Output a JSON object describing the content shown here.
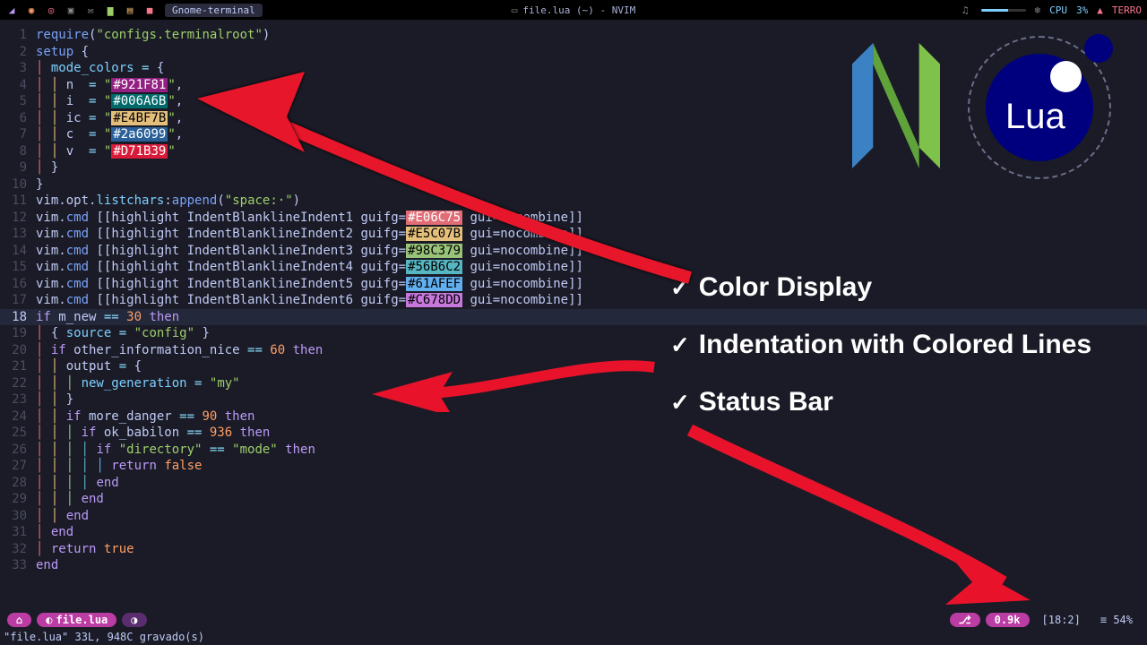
{
  "topbar": {
    "term_label": "Gnome-terminal",
    "file_label": "file.lua (~) - NVIM",
    "cpu_label": "CPU",
    "cpu_pct": "3%",
    "user": "TERRO"
  },
  "annotations": {
    "a1": "Color Display",
    "a2": "Indentation with Colored Lines",
    "a3": "Status Bar"
  },
  "code_lines": [
    {
      "n": "1",
      "tokens": [
        [
          "fn",
          "require"
        ],
        [
          "punct",
          "("
        ],
        [
          "str",
          "\"configs.terminalroot\""
        ],
        [
          "punct",
          ")"
        ]
      ]
    },
    {
      "n": "2",
      "tokens": [
        [
          "fn",
          "setup"
        ],
        [
          "punct",
          " {"
        ]
      ]
    },
    {
      "n": "3",
      "tokens": [
        [
          "indent1",
          "│ "
        ],
        [
          "prop",
          "mode_colors"
        ],
        [
          "op",
          " = "
        ],
        [
          "punct",
          "{"
        ]
      ]
    },
    {
      "n": "4",
      "tokens": [
        [
          "indent1",
          "│ "
        ],
        [
          "indent2",
          "│ "
        ],
        [
          "var",
          "n "
        ],
        [
          "op",
          " = "
        ],
        [
          "str",
          "\""
        ],
        [
          "swc",
          "#921F81",
          "#921F81"
        ],
        [
          "str",
          "\""
        ],
        [
          "punct",
          ","
        ]
      ]
    },
    {
      "n": "5",
      "tokens": [
        [
          "indent1",
          "│ "
        ],
        [
          "indent2",
          "│ "
        ],
        [
          "var",
          "i "
        ],
        [
          "op",
          " = "
        ],
        [
          "str",
          "\""
        ],
        [
          "swc",
          "#006A6B",
          "#006A6B"
        ],
        [
          "str",
          "\""
        ],
        [
          "punct",
          ","
        ]
      ]
    },
    {
      "n": "6",
      "tokens": [
        [
          "indent1",
          "│ "
        ],
        [
          "indent2",
          "│ "
        ],
        [
          "var",
          "ic"
        ],
        [
          "op",
          " = "
        ],
        [
          "str",
          "\""
        ],
        [
          "swc",
          "#E4BF7B",
          "#E4BF7B"
        ],
        [
          "str",
          "\""
        ],
        [
          "punct",
          ","
        ]
      ]
    },
    {
      "n": "7",
      "tokens": [
        [
          "indent1",
          "│ "
        ],
        [
          "indent2",
          "│ "
        ],
        [
          "var",
          "c "
        ],
        [
          "op",
          " = "
        ],
        [
          "str",
          "\""
        ],
        [
          "swc",
          "#2a6099",
          "#2a6099"
        ],
        [
          "str",
          "\""
        ],
        [
          "punct",
          ","
        ]
      ]
    },
    {
      "n": "8",
      "tokens": [
        [
          "indent1",
          "│ "
        ],
        [
          "indent2",
          "│ "
        ],
        [
          "var",
          "v "
        ],
        [
          "op",
          " = "
        ],
        [
          "str",
          "\""
        ],
        [
          "swc",
          "#D71B39",
          "#D71B39"
        ],
        [
          "str",
          "\""
        ]
      ]
    },
    {
      "n": "9",
      "tokens": [
        [
          "indent1",
          "│ "
        ],
        [
          "punct",
          "}"
        ]
      ]
    },
    {
      "n": "10",
      "tokens": [
        [
          "punct",
          "}"
        ]
      ]
    },
    {
      "n": "11",
      "tokens": [
        [
          "var",
          "vim"
        ],
        [
          "punct",
          "."
        ],
        [
          "var",
          "opt"
        ],
        [
          "punct",
          "."
        ],
        [
          "prop",
          "listchars"
        ],
        [
          "punct",
          ":"
        ],
        [
          "fn",
          "append"
        ],
        [
          "punct",
          "("
        ],
        [
          "str",
          "\"space:·\""
        ],
        [
          "punct",
          ")"
        ]
      ]
    },
    {
      "n": "12",
      "tokens": [
        [
          "var",
          "vim"
        ],
        [
          "punct",
          "."
        ],
        [
          "fn",
          "cmd"
        ],
        [
          "punct",
          " [["
        ],
        [
          "var",
          "highlight IndentBlanklineIndent1 guifg="
        ],
        [
          "swc",
          "#E06C75",
          "#E06C75"
        ],
        [
          "var",
          " gui=nocombine"
        ],
        [
          "punct",
          "]]"
        ]
      ]
    },
    {
      "n": "13",
      "tokens": [
        [
          "var",
          "vim"
        ],
        [
          "punct",
          "."
        ],
        [
          "fn",
          "cmd"
        ],
        [
          "punct",
          " [["
        ],
        [
          "var",
          "highlight IndentBlanklineIndent2 guifg="
        ],
        [
          "swc",
          "#E5C07B",
          "#E5C07B"
        ],
        [
          "var",
          " gui=nocombine"
        ],
        [
          "punct",
          "]]"
        ]
      ]
    },
    {
      "n": "14",
      "tokens": [
        [
          "var",
          "vim"
        ],
        [
          "punct",
          "."
        ],
        [
          "fn",
          "cmd"
        ],
        [
          "punct",
          " [["
        ],
        [
          "var",
          "highlight IndentBlanklineIndent3 guifg="
        ],
        [
          "swc",
          "#98C379",
          "#98C379"
        ],
        [
          "var",
          " gui=nocombine"
        ],
        [
          "punct",
          "]]"
        ]
      ]
    },
    {
      "n": "15",
      "tokens": [
        [
          "var",
          "vim"
        ],
        [
          "punct",
          "."
        ],
        [
          "fn",
          "cmd"
        ],
        [
          "punct",
          " [["
        ],
        [
          "var",
          "highlight IndentBlanklineIndent4 guifg="
        ],
        [
          "swc",
          "#56B6C2",
          "#56B6C2"
        ],
        [
          "var",
          " gui=nocombine"
        ],
        [
          "punct",
          "]]"
        ]
      ]
    },
    {
      "n": "16",
      "tokens": [
        [
          "var",
          "vim"
        ],
        [
          "punct",
          "."
        ],
        [
          "fn",
          "cmd"
        ],
        [
          "punct",
          " [["
        ],
        [
          "var",
          "highlight IndentBlanklineIndent5 guifg="
        ],
        [
          "swc",
          "#61AFEF",
          "#61AFEF"
        ],
        [
          "var",
          " gui=nocombine"
        ],
        [
          "punct",
          "]]"
        ]
      ]
    },
    {
      "n": "17",
      "tokens": [
        [
          "var",
          "vim"
        ],
        [
          "punct",
          "."
        ],
        [
          "fn",
          "cmd"
        ],
        [
          "punct",
          " [["
        ],
        [
          "var",
          "highlight IndentBlanklineIndent6 guifg="
        ],
        [
          "swc",
          "#C678DD",
          "#C678DD"
        ],
        [
          "var",
          " gui=nocombine"
        ],
        [
          "punct",
          "]]"
        ]
      ]
    },
    {
      "n": "18",
      "current": true,
      "tokens": [
        [
          "kw",
          "if"
        ],
        [
          "var",
          " m_new "
        ],
        [
          "op",
          "=="
        ],
        [
          "num",
          " 30 "
        ],
        [
          "kw",
          "then"
        ]
      ]
    },
    {
      "n": "19",
      "tokens": [
        [
          "indent1",
          "│ "
        ],
        [
          "punct",
          "{ "
        ],
        [
          "prop",
          "source"
        ],
        [
          "op",
          " = "
        ],
        [
          "str",
          "\"config\""
        ],
        [
          "punct",
          " }"
        ]
      ]
    },
    {
      "n": "20",
      "tokens": [
        [
          "indent1",
          "│ "
        ],
        [
          "kw",
          "if"
        ],
        [
          "var",
          " other_information_nice "
        ],
        [
          "op",
          "=="
        ],
        [
          "num",
          " 60 "
        ],
        [
          "kw",
          "then"
        ]
      ]
    },
    {
      "n": "21",
      "tokens": [
        [
          "indent1",
          "│ "
        ],
        [
          "indent2",
          "│ "
        ],
        [
          "var",
          "output "
        ],
        [
          "op",
          "= "
        ],
        [
          "punct",
          "{"
        ]
      ]
    },
    {
      "n": "22",
      "tokens": [
        [
          "indent1",
          "│ "
        ],
        [
          "indent2",
          "│ "
        ],
        [
          "indent3",
          "│ "
        ],
        [
          "prop",
          "new_generation"
        ],
        [
          "op",
          " = "
        ],
        [
          "str",
          "\"my\""
        ]
      ]
    },
    {
      "n": "23",
      "tokens": [
        [
          "indent1",
          "│ "
        ],
        [
          "indent2",
          "│ "
        ],
        [
          "punct",
          "}"
        ]
      ]
    },
    {
      "n": "24",
      "tokens": [
        [
          "indent1",
          "│ "
        ],
        [
          "indent2",
          "│ "
        ],
        [
          "kw",
          "if"
        ],
        [
          "var",
          " more_danger "
        ],
        [
          "op",
          "=="
        ],
        [
          "num",
          " 90 "
        ],
        [
          "kw",
          "then"
        ]
      ]
    },
    {
      "n": "25",
      "tokens": [
        [
          "indent1",
          "│ "
        ],
        [
          "indent2",
          "│ "
        ],
        [
          "indent3",
          "│ "
        ],
        [
          "kw",
          "if"
        ],
        [
          "var",
          " ok_babilon "
        ],
        [
          "op",
          "=="
        ],
        [
          "num",
          " 936 "
        ],
        [
          "kw",
          "then"
        ]
      ]
    },
    {
      "n": "26",
      "tokens": [
        [
          "indent1",
          "│ "
        ],
        [
          "indent2",
          "│ "
        ],
        [
          "indent3",
          "│ "
        ],
        [
          "indent4",
          "│ "
        ],
        [
          "kw",
          "if"
        ],
        [
          "str",
          " \"directory\" "
        ],
        [
          "op",
          "=="
        ],
        [
          "str",
          " \"mode\" "
        ],
        [
          "kw",
          "then"
        ]
      ]
    },
    {
      "n": "27",
      "tokens": [
        [
          "indent1",
          "│ "
        ],
        [
          "indent2",
          "│ "
        ],
        [
          "indent3",
          "│ "
        ],
        [
          "indent4",
          "│ "
        ],
        [
          "indent5",
          "│ "
        ],
        [
          "kw",
          "return "
        ],
        [
          "bool",
          "false"
        ]
      ]
    },
    {
      "n": "28",
      "tokens": [
        [
          "indent1",
          "│ "
        ],
        [
          "indent2",
          "│ "
        ],
        [
          "indent3",
          "│ "
        ],
        [
          "indent4",
          "│ "
        ],
        [
          "kw",
          "end"
        ]
      ]
    },
    {
      "n": "29",
      "tokens": [
        [
          "indent1",
          "│ "
        ],
        [
          "indent2",
          "│ "
        ],
        [
          "indent3",
          "│ "
        ],
        [
          "kw",
          "end"
        ]
      ]
    },
    {
      "n": "30",
      "tokens": [
        [
          "indent1",
          "│ "
        ],
        [
          "indent2",
          "│ "
        ],
        [
          "kw",
          "end"
        ]
      ]
    },
    {
      "n": "31",
      "tokens": [
        [
          "indent1",
          "│ "
        ],
        [
          "kw",
          "end"
        ]
      ]
    },
    {
      "n": "32",
      "tokens": [
        [
          "indent1",
          "│ "
        ],
        [
          "kw",
          "return "
        ],
        [
          "bool",
          "true"
        ]
      ]
    },
    {
      "n": "33",
      "tokens": [
        [
          "kw",
          "end"
        ]
      ]
    }
  ],
  "status": {
    "home": "⌂",
    "filename": "file.lua",
    "lua_icon": "○",
    "git_icon": "⎇",
    "size": "0.9k",
    "pos": "[18:2]",
    "pct": "≡ 54%"
  },
  "cmdline": "\"file.lua\" 33L, 948C gravado(s)",
  "lua_label": "Lua"
}
